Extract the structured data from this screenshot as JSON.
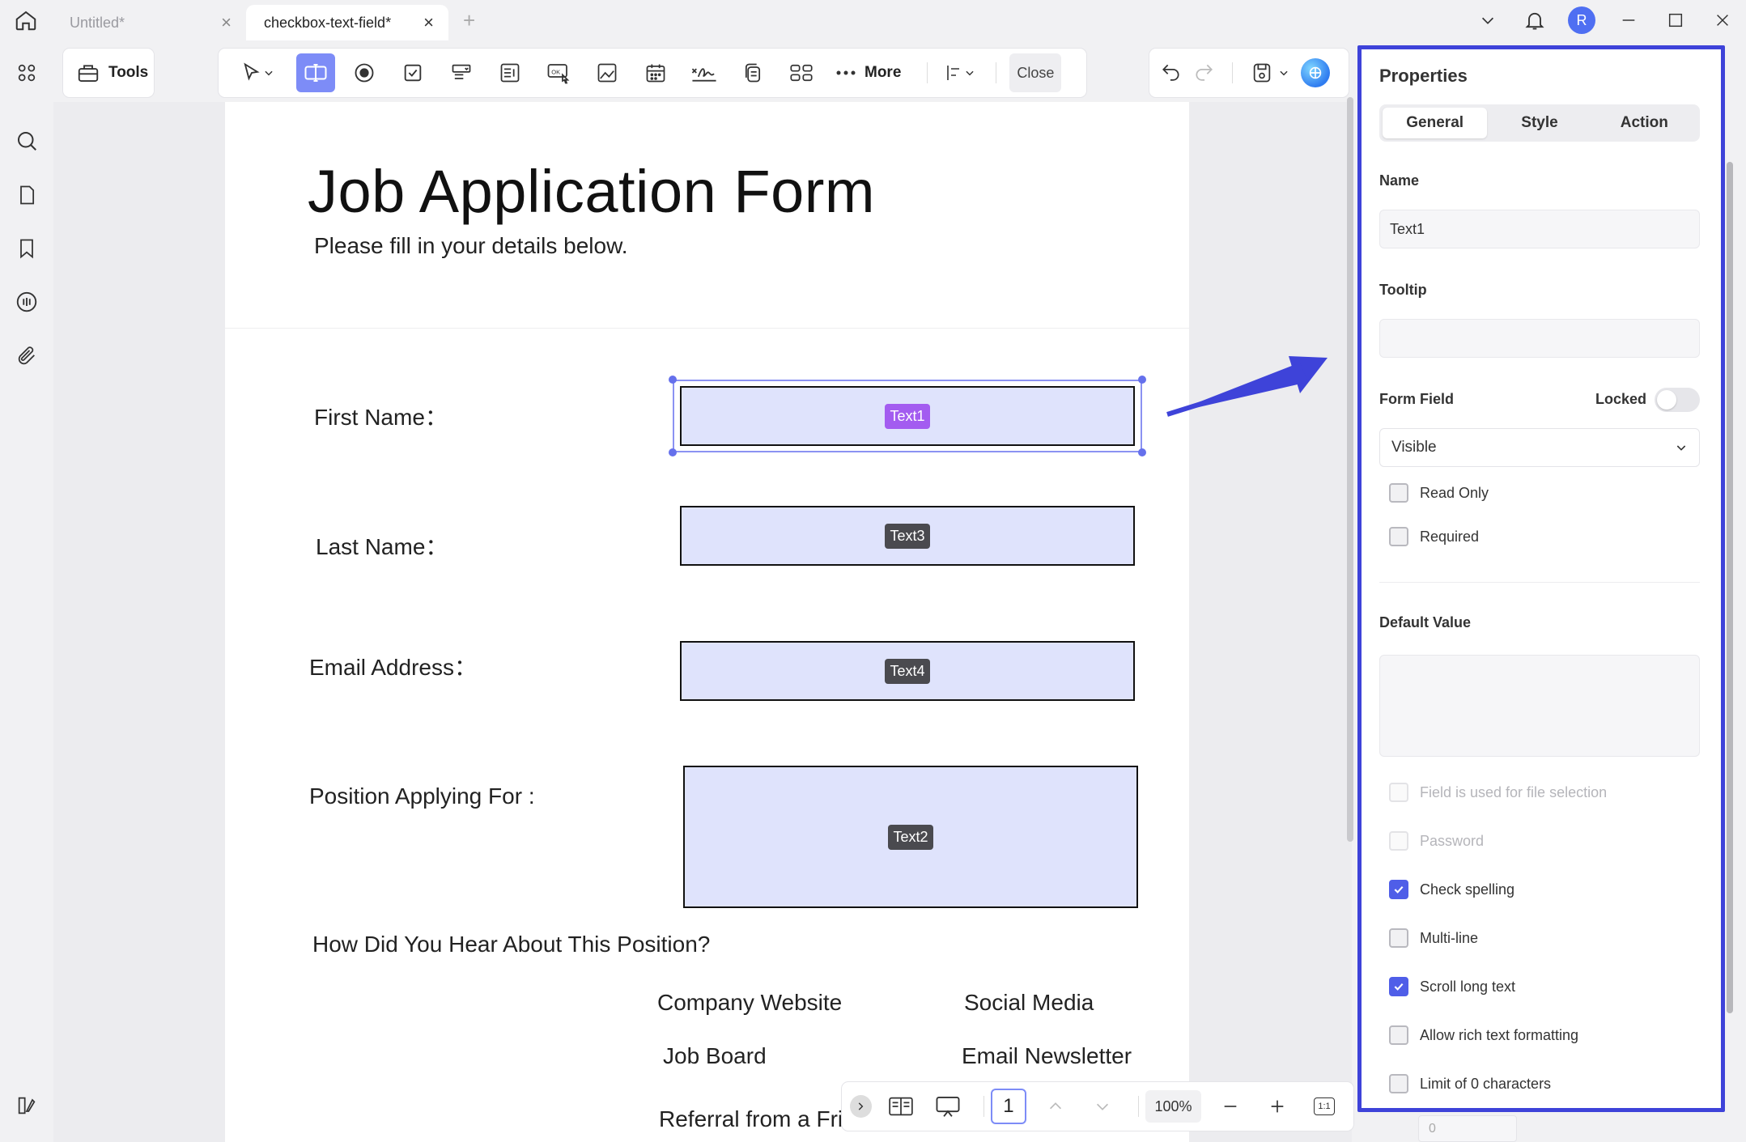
{
  "tabs": [
    {
      "label": "Untitled*",
      "active": false
    },
    {
      "label": "checkbox-text-field*",
      "active": true
    }
  ],
  "user": {
    "initial": "R",
    "avatar_color": "#4f6ff2"
  },
  "toolbar": {
    "tools_label": "Tools",
    "more_label": "More",
    "close_label": "Close",
    "accent_color": "#7d8cf7"
  },
  "document": {
    "title": "Job Application Form",
    "subtitle": "Please fill in your details below.",
    "fields": [
      {
        "label": "First Name：",
        "tag": "Text1",
        "selected": true
      },
      {
        "label": "Last Name：",
        "tag": "Text3",
        "selected": false
      },
      {
        "label": "Email Address：",
        "tag": "Text4",
        "selected": false
      },
      {
        "label": "Position Applying For :",
        "tag": "Text2",
        "selected": false
      }
    ],
    "question": "How Did You Hear About This Position?",
    "options": [
      "Company Website",
      "Social Media",
      "Job Board",
      "Email Newsletter",
      "Referral from a Fri"
    ]
  },
  "bottombar": {
    "page": "1",
    "zoom": "100%",
    "fit_label": "1:1"
  },
  "properties": {
    "title": "Properties",
    "tabs": [
      "General",
      "Style",
      "Action"
    ],
    "active_tab": "General",
    "name_label": "Name",
    "name_value": "Text1",
    "tooltip_label": "Tooltip",
    "tooltip_value": "",
    "form_field_label": "Form Field",
    "locked_label": "Locked",
    "locked": false,
    "visibility": "Visible",
    "read_only_label": "Read Only",
    "required_label": "Required",
    "default_value_label": "Default Value",
    "options": [
      {
        "label": "Field is used for file selection",
        "checked": false,
        "disabled": true
      },
      {
        "label": "Password",
        "checked": false,
        "disabled": true
      },
      {
        "label": "Check spelling",
        "checked": true,
        "disabled": false
      },
      {
        "label": "Multi-line",
        "checked": false,
        "disabled": false
      },
      {
        "label": "Scroll long text",
        "checked": true,
        "disabled": false
      },
      {
        "label": "Allow rich text formatting",
        "checked": false,
        "disabled": false
      },
      {
        "label": "Limit of 0 characters",
        "checked": false,
        "disabled": false
      }
    ],
    "limit_value": "0",
    "highlight_color": "#3e43d9",
    "check_color": "#4f5ee8"
  }
}
